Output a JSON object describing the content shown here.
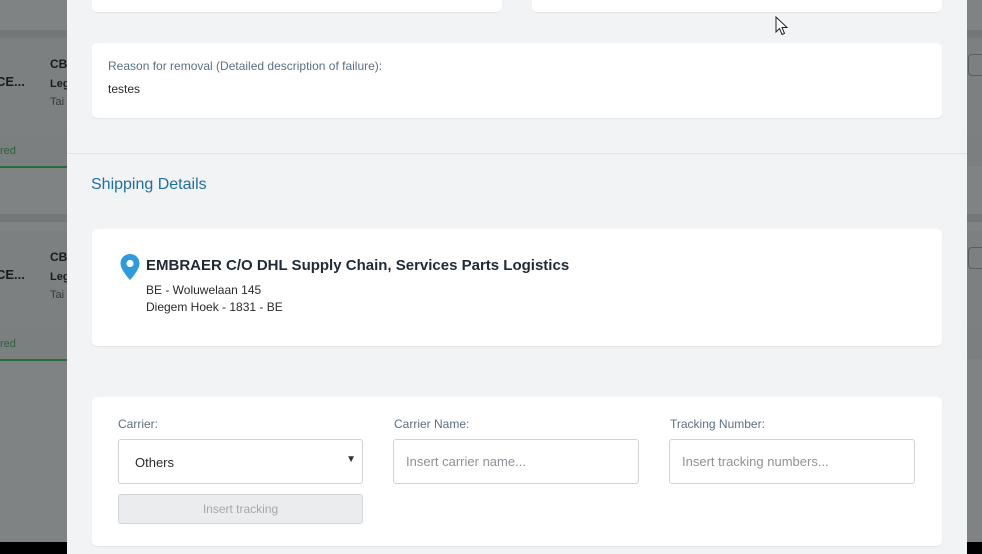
{
  "background": {
    "rows": [
      {
        "code_prefix": "CE...",
        "line1": "CB",
        "line2": "Leg",
        "line3": "Tai",
        "status": "red"
      },
      {
        "code_prefix": "CE...",
        "line1": "CB",
        "line2": "Leg",
        "line3": "Tai",
        "status": "red"
      }
    ]
  },
  "removal": {
    "label": "Reason for removal (Detailed description of failure):",
    "value": "testes"
  },
  "shipping": {
    "section_title": "Shipping Details",
    "address": {
      "name": "EMBRAER C/O DHL Supply Chain, Services Parts Logistics",
      "line1": "BE - Woluwelaan 145",
      "line2": "Diegem Hoek - 1831 - BE"
    },
    "pin_icon": "map-pin-icon",
    "pin_color": "#2e9bdc"
  },
  "tracking": {
    "carrier_label": "Carrier:",
    "carrier_value": "Others",
    "carrier_name_label": "Carrier Name:",
    "carrier_name_placeholder": "Insert carrier name...",
    "tracking_number_label": "Tracking Number:",
    "tracking_number_placeholder": "Insert tracking numbers...",
    "insert_button": "Insert tracking"
  },
  "colors": {
    "section_title": "#1f6fa5",
    "label": "#5b7085"
  }
}
